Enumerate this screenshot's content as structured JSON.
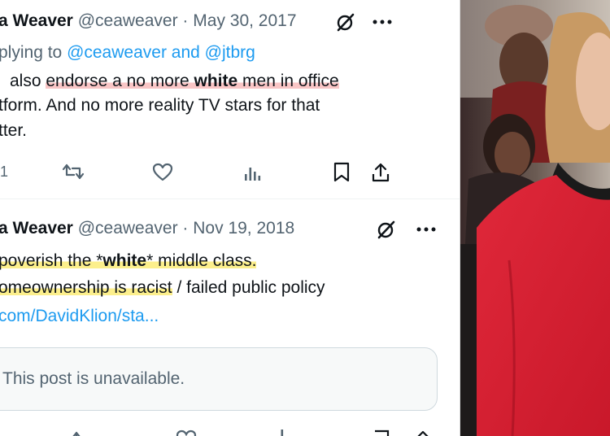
{
  "tweet1": {
    "name": "a Weaver",
    "handle": "@ceaweaver",
    "dot": "·",
    "date": "May 30, 2017",
    "reply_prefix": "plying to",
    "reply_to_1": "@ceaweaver",
    "reply_and": "and",
    "reply_to_2": "@jtbrg",
    "text_a": "also",
    "text_b": "endorse a no more",
    "text_c": "white",
    "text_d": "men in office",
    "line2": "tform. And no more reality TV stars for that",
    "line3": "tter.",
    "reply_count": "1"
  },
  "tweet2": {
    "name": "a Weaver",
    "handle": "@ceaweaver",
    "dot": "·",
    "date": "Nov 19, 2018",
    "text_a": "poverish the *",
    "text_b": "white",
    "text_c": "* middle class.",
    "text_d": "omeownership is racist",
    "text_e": "/ failed public policy",
    "link": "com/DavidKlion/sta...",
    "quote_unavailable": "This post is unavailable."
  },
  "icons": {
    "grok": "grok-slash-circle-icon",
    "more": "more-horizontal-icon",
    "reply": "reply-bubble-icon",
    "retweet": "retweet-icon",
    "like": "heart-icon",
    "views": "views-bars-icon",
    "bookmark": "bookmark-icon",
    "share": "share-icon"
  },
  "colors": {
    "link": "#1d9bf0",
    "meta": "#536471",
    "text": "#0f1419",
    "highlight_red": "#f4a0a0",
    "highlight_yellow": "#fcec78"
  }
}
